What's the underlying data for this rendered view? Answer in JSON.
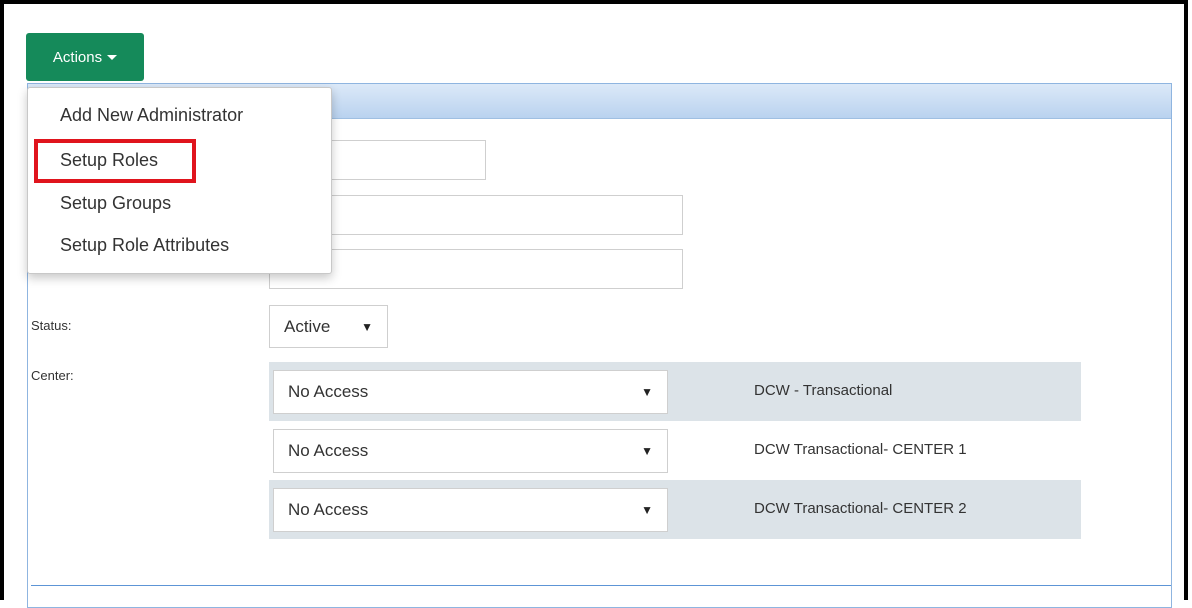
{
  "toolbar": {
    "actions_label": "Actions"
  },
  "menu": {
    "items": [
      {
        "label": "Add New Administrator"
      },
      {
        "label": "Setup Roles"
      },
      {
        "label": "Setup Groups"
      },
      {
        "label": "Setup Role Attributes"
      }
    ],
    "highlighted_item": "Setup Roles"
  },
  "form": {
    "status_label": "Status:",
    "status_value": "Active",
    "center_label": "Center:",
    "centers": [
      {
        "access": "No Access",
        "name": "DCW - Transactional"
      },
      {
        "access": "No Access",
        "name": "DCW Transactional- CENTER 1"
      },
      {
        "access": "No Access",
        "name": "DCW Transactional- CENTER 2"
      }
    ]
  },
  "colors": {
    "actions_button": "#158a5a",
    "highlight_border": "#e0141d",
    "panel_header": "#c7dbf2",
    "row_shade": "#dce3e8"
  }
}
